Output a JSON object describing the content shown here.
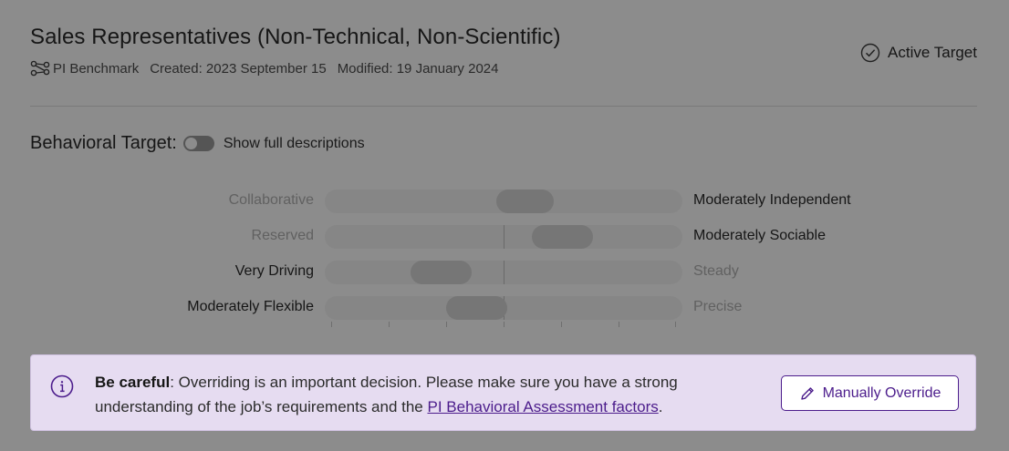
{
  "header": {
    "title": "Sales Representatives (Non-Technical, Non-Scientific)",
    "benchmark_icon": "share-network-icon",
    "benchmark": "PI Benchmark",
    "created": "Created: 2023 September 15",
    "modified": "Modified: 19 January 2024",
    "status_icon": "check-circle-icon",
    "status": "Active Target"
  },
  "behavioral": {
    "label": "Behavioral Target:",
    "toggle_on": false,
    "toggle_label": "Show full descriptions"
  },
  "factors": [
    {
      "left": "Collaborative",
      "right": "Moderately Independent",
      "emphasis": "right",
      "range": [
        0.48,
        0.64
      ]
    },
    {
      "left": "Reserved",
      "right": "Moderately Sociable",
      "emphasis": "right",
      "range": [
        0.58,
        0.75
      ]
    },
    {
      "left": "Very Driving",
      "right": "Steady",
      "emphasis": "left",
      "range": [
        0.24,
        0.41
      ]
    },
    {
      "left": "Moderately Flexible",
      "right": "Precise",
      "emphasis": "left",
      "range": [
        0.34,
        0.51
      ]
    }
  ],
  "banner": {
    "icon": "info-circle-icon",
    "bold": "Be careful",
    "text": ": Overriding is an important decision. Please make sure you have a strong understanding of the job’s requirements and the ",
    "link": "PI Behavioral Assessment factors",
    "end": ".",
    "button_icon": "pencil-icon",
    "button_label": "Manually Override"
  },
  "colors": {
    "accent": "#4c1d8c",
    "banner_bg": "#e6dcf1"
  }
}
